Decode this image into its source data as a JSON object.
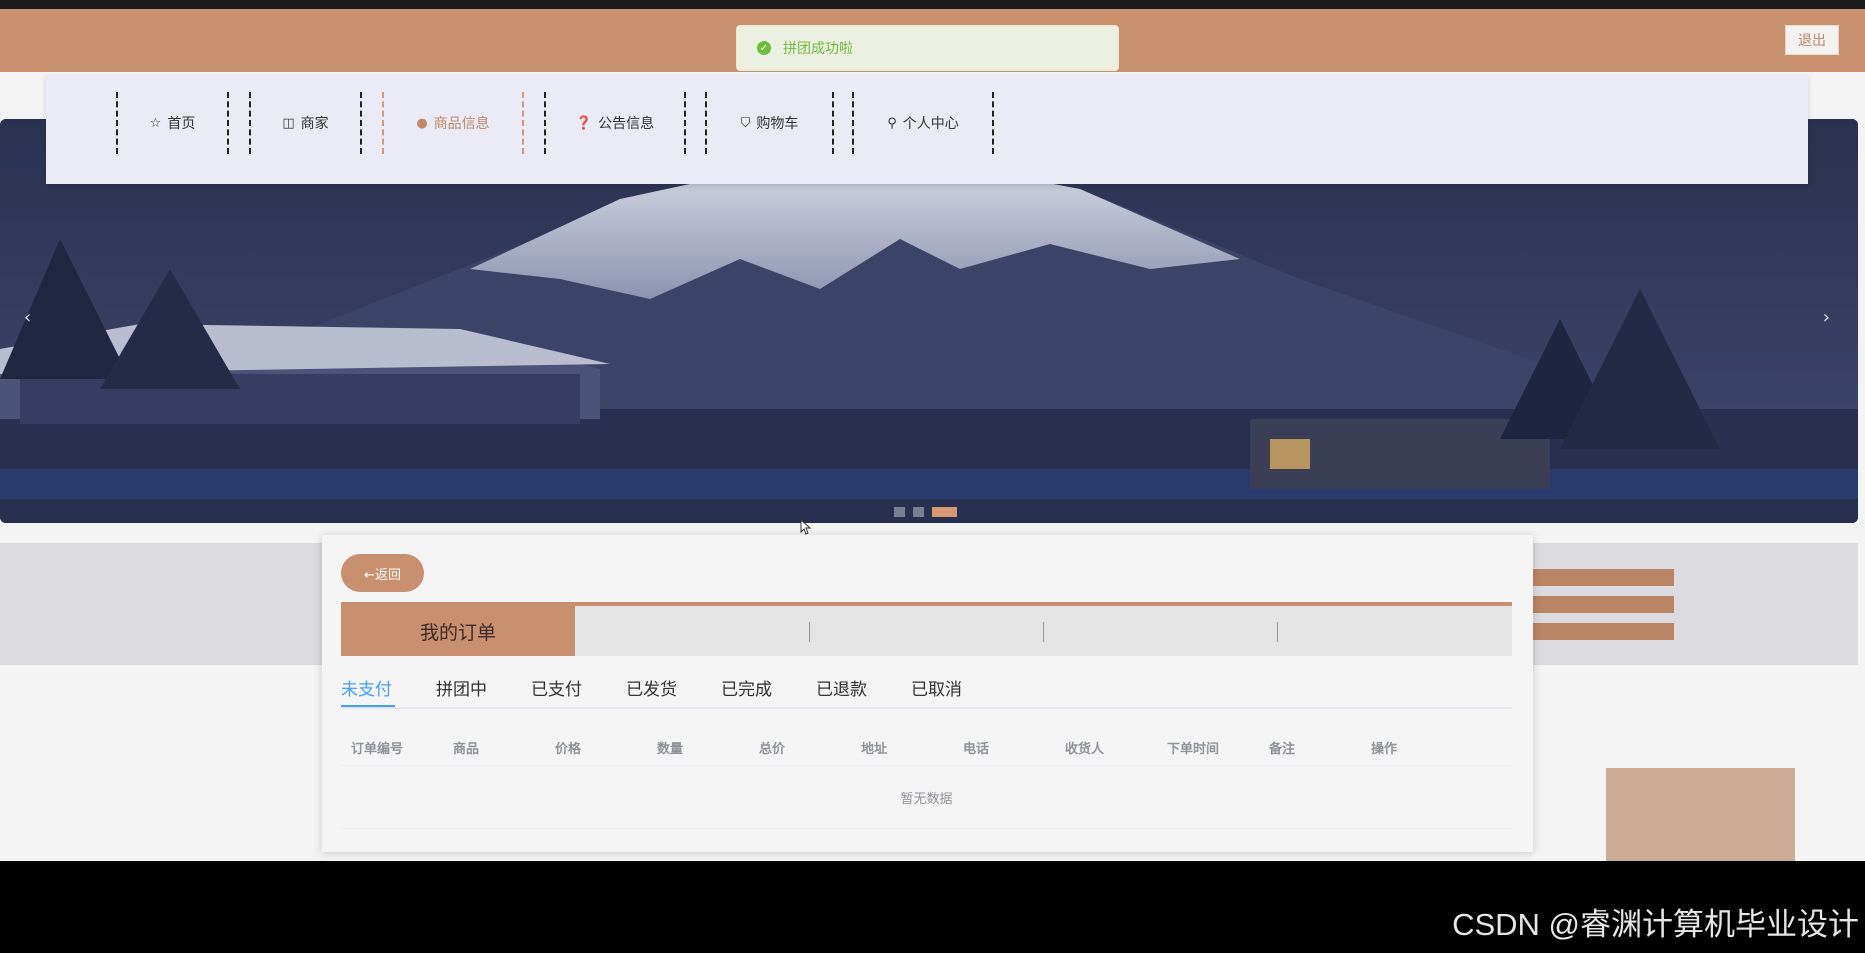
{
  "header": {
    "title": "",
    "logout_label": "退出",
    "bg_color": "#c8906f"
  },
  "toast": {
    "message": "拼团成功啦",
    "icon": "check-circle-icon",
    "color": "#67c23a"
  },
  "nav": {
    "items": [
      {
        "label": "首页",
        "icon": "star-icon"
      },
      {
        "label": "商家",
        "icon": "bag-icon"
      },
      {
        "label": "商品信息",
        "icon": "info-circle-icon",
        "active": true
      },
      {
        "label": "公告信息",
        "icon": "question-circle-icon"
      },
      {
        "label": "购物车",
        "icon": "cart-icon"
      },
      {
        "label": "个人中心",
        "icon": "user-icon"
      }
    ]
  },
  "carousel": {
    "prev_icon": "chevron-left-icon",
    "next_icon": "chevron-right-icon",
    "slide_count": 3,
    "active_index": 2
  },
  "orders": {
    "back_label": "←返回",
    "title": "我的订单",
    "tabs": [
      "未支付",
      "拼团中",
      "已支付",
      "已发货",
      "已完成",
      "已退款",
      "已取消"
    ],
    "active_tab": 0,
    "columns": [
      "订单编号",
      "商品",
      "价格",
      "数量",
      "总价",
      "地址",
      "电话",
      "收货人",
      "下单时间",
      "备注",
      "操作"
    ],
    "empty_text": "暂无数据"
  },
  "watermark": "CSDN @睿渊计算机毕业设计",
  "colors": {
    "accent": "#c8906f",
    "tab_active": "#409eff"
  }
}
